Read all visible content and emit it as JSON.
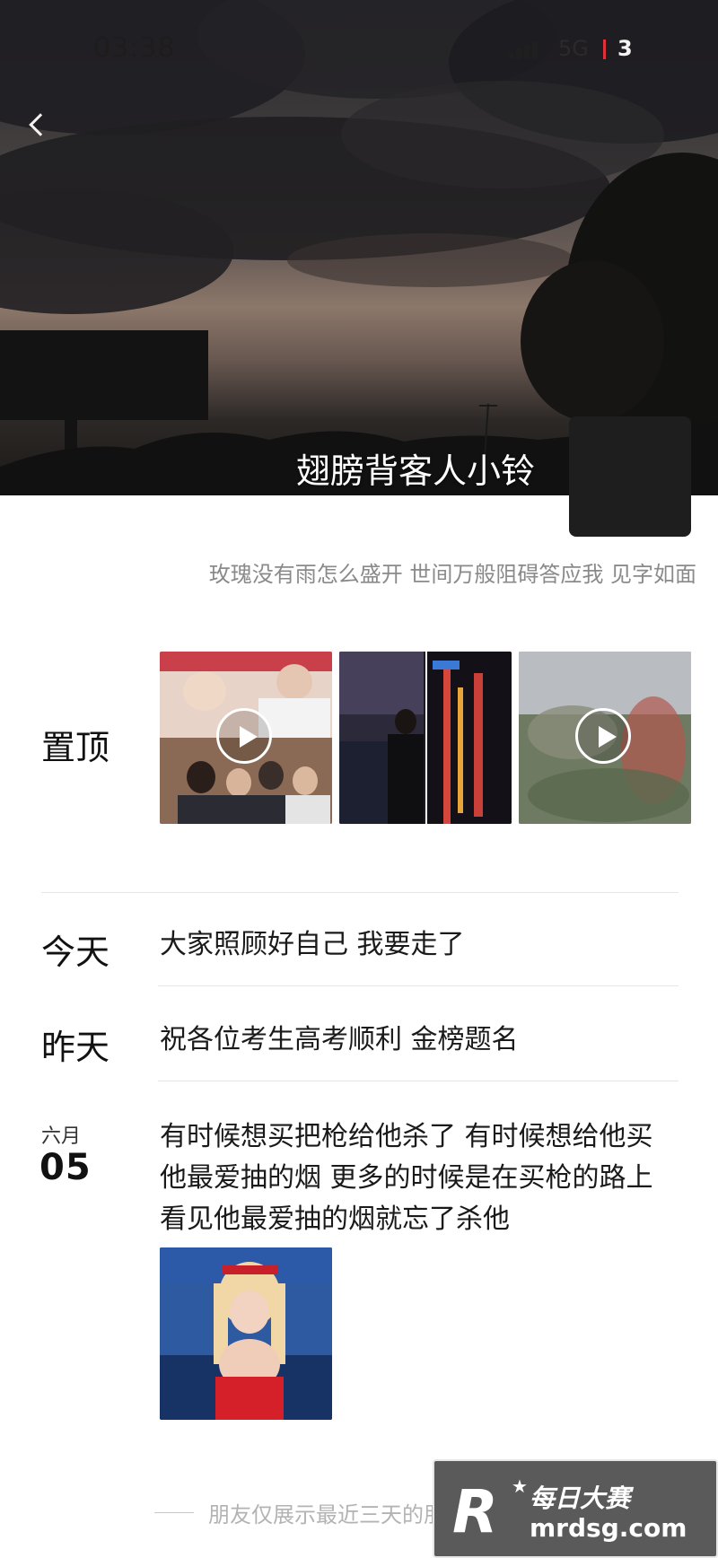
{
  "status_bar": {
    "time": "03:38",
    "network": "5G",
    "battery": "3"
  },
  "profile": {
    "nickname": "翅膀背客人小铃",
    "signature": "玫瑰没有雨怎么盛开 世间万般阻碍答应我 见字如面"
  },
  "pinned": {
    "label": "置顶"
  },
  "posts": [
    {
      "date": "今天",
      "text": "大家照顾好自己 我要走了"
    },
    {
      "date": "昨天",
      "text": "祝各位考生高考顺利 金榜题名"
    },
    {
      "month": "六月",
      "day": "05",
      "text_lines": [
        "有时候想买把枪给他杀了 有时候想给他买",
        "他最爱抽的烟 更多的时候是在买枪的路上",
        "看见他最爱抽的烟就忘了杀他"
      ]
    }
  ],
  "footer": {
    "note": "朋友仅展示最近三天的朋友圈"
  },
  "watermark": {
    "logo": "R",
    "title": "每日大赛",
    "url": "mrdsg.com"
  },
  "icons": {
    "back": "chevron-left-icon",
    "play": "play-icon",
    "signal": "signal-bars-icon"
  },
  "colors": {
    "background": "#ffffff",
    "text_primary": "#111111",
    "text_secondary": "#8a8a8a",
    "divider": "#e6e6e6",
    "battery_separator": "#e0313b"
  }
}
